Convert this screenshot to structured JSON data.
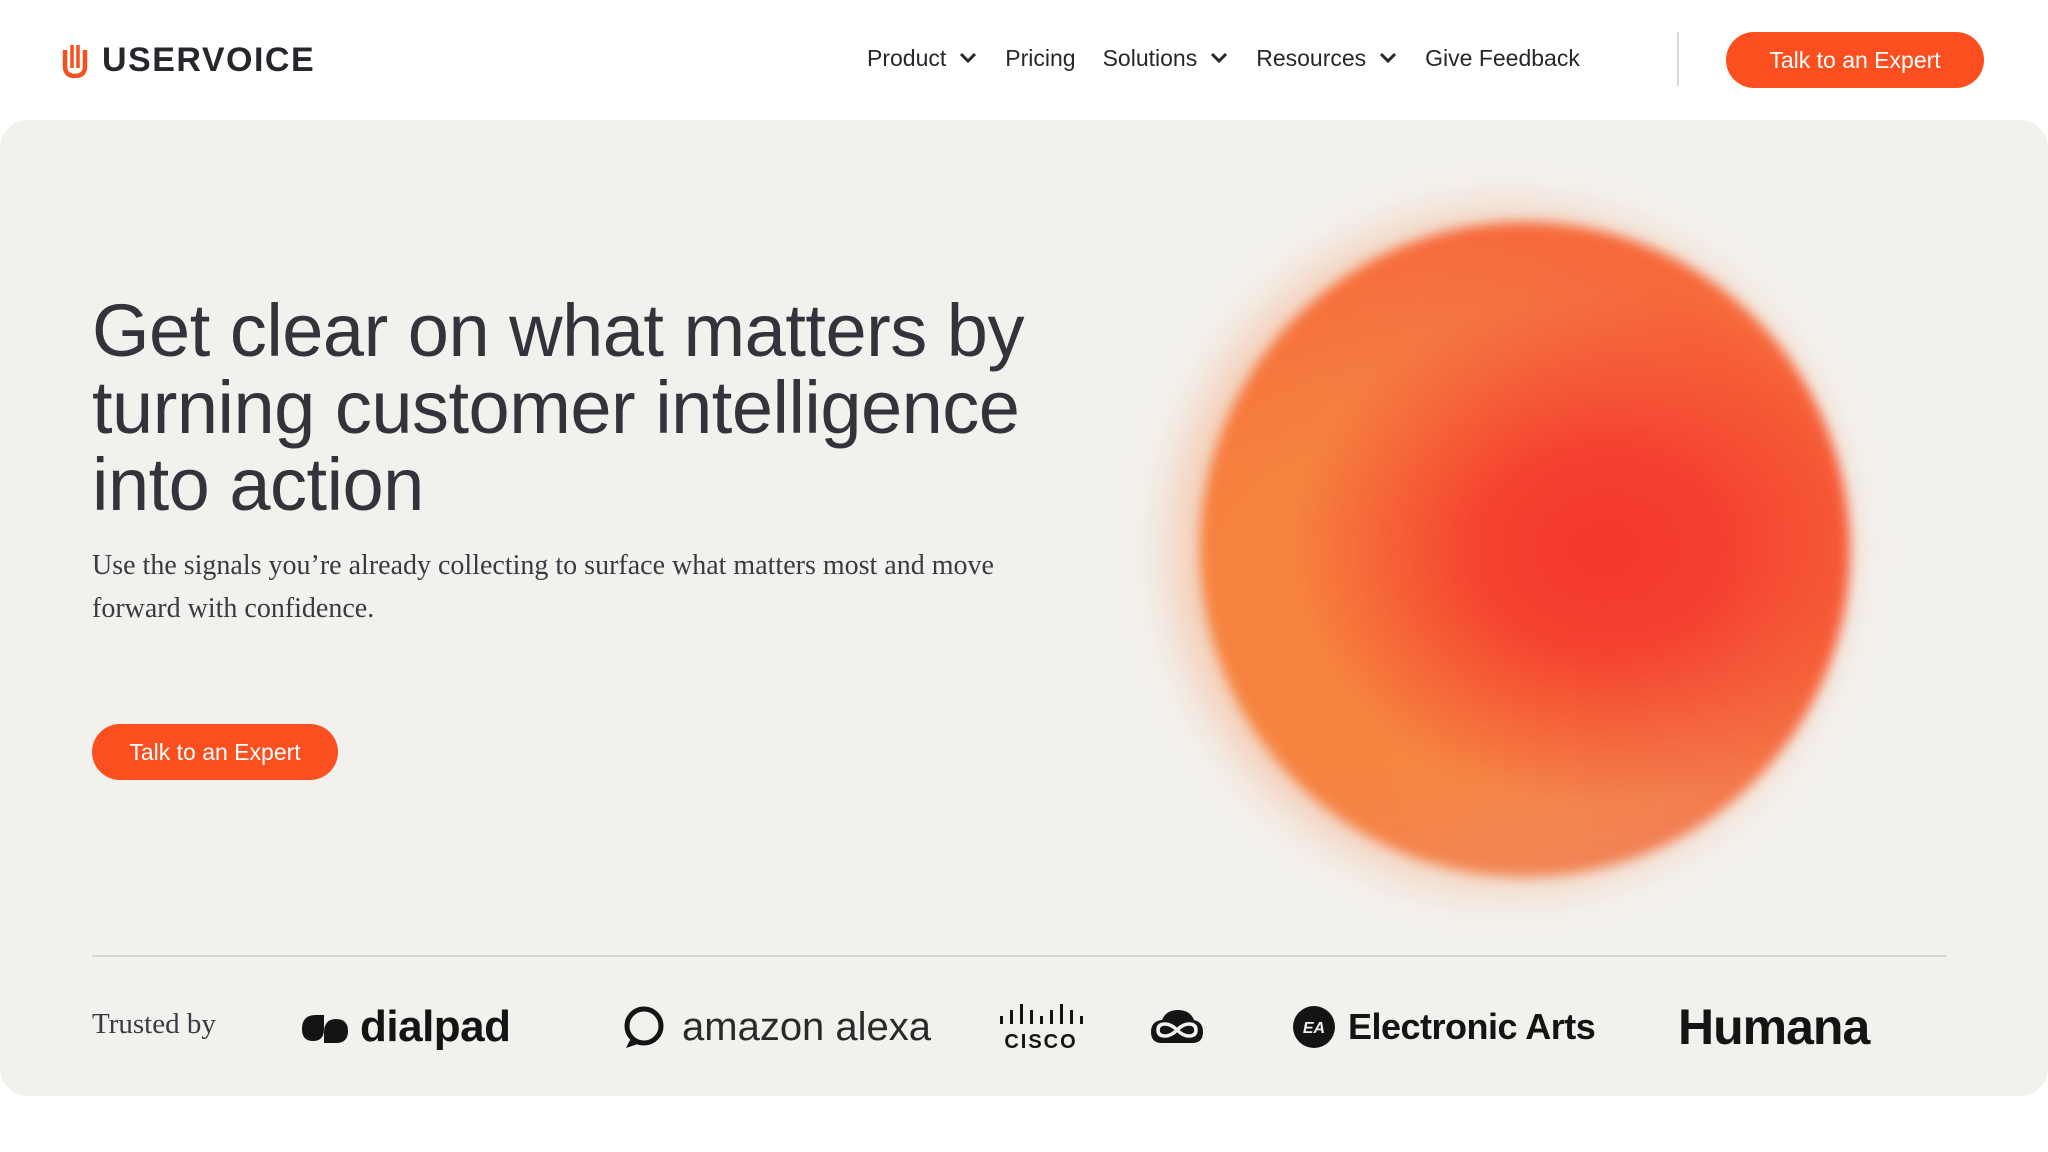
{
  "nav": {
    "brand": "USERVOICE",
    "items": [
      {
        "label": "Product",
        "has_dropdown": true
      },
      {
        "label": "Pricing",
        "has_dropdown": false
      },
      {
        "label": "Solutions",
        "has_dropdown": true
      },
      {
        "label": "Resources",
        "has_dropdown": true
      },
      {
        "label": "Give Feedback",
        "has_dropdown": false
      }
    ],
    "cta_label": "Talk to an Expert"
  },
  "hero": {
    "headline": "Get clear on what matters by turning customer intelligence into action",
    "subhead": "Use the signals you’re already collecting to surface what matters most and move forward with confidence.",
    "cta_label": "Talk to an Expert"
  },
  "trusted": {
    "label": "Trusted by",
    "logos": [
      {
        "name": "dialpad",
        "text": "dialpad"
      },
      {
        "name": "amazon-alexa",
        "text": "amazon alexa"
      },
      {
        "name": "cisco",
        "text": "CISCO"
      },
      {
        "name": "creative-cloud",
        "text": ""
      },
      {
        "name": "electronic-arts",
        "text": "Electronic Arts",
        "badge": "EA"
      },
      {
        "name": "humana",
        "text": "Humana"
      }
    ]
  },
  "colors": {
    "accent": "#fb4f1f",
    "hero_bg": "#f3f1ed",
    "text": "#2f3037"
  }
}
